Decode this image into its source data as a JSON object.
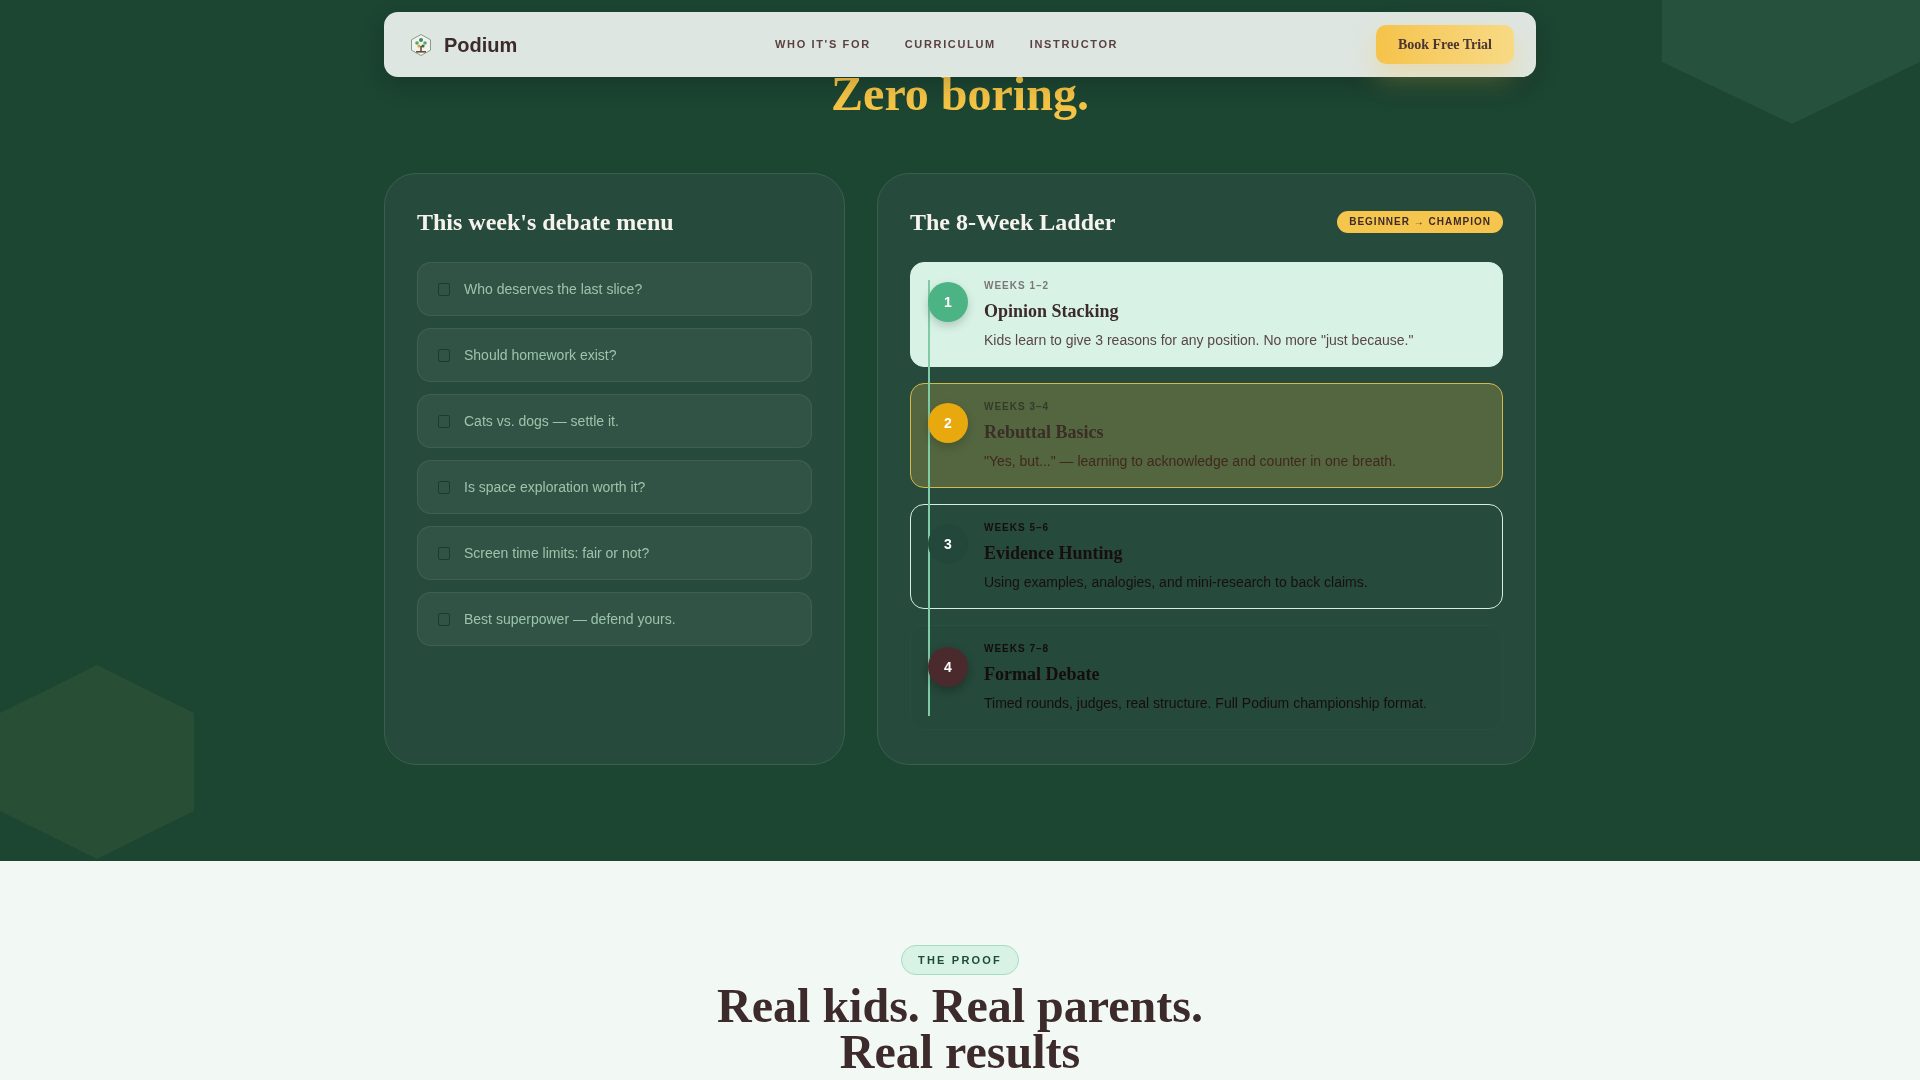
{
  "navbar": {
    "brand": "Podium",
    "links": [
      {
        "label": "WHO IT'S FOR"
      },
      {
        "label": "CURRICULUM"
      },
      {
        "label": "INSTRUCTOR"
      }
    ],
    "cta": "Book Free Trial"
  },
  "hero": {
    "headline": "Zero boring."
  },
  "debate_menu": {
    "title": "This week's debate menu",
    "items": [
      {
        "label": "Who deserves the last slice?",
        "checked": false
      },
      {
        "label": "Should homework exist?",
        "checked": false
      },
      {
        "label": "Cats vs. dogs — settle it.",
        "checked": false
      },
      {
        "label": "Is space exploration worth it?",
        "checked": false
      },
      {
        "label": "Screen time limits: fair or not?",
        "checked": false
      },
      {
        "label": "Best superpower — defend yours.",
        "checked": false
      }
    ]
  },
  "ladder": {
    "title": "The 8-Week Ladder",
    "badge": "BEGINNER → CHAMPION",
    "steps": [
      {
        "kind": "mint",
        "number": "1",
        "weeks": "WEEKS 1–2",
        "title": "Opinion Stacking",
        "description": "Kids learn to give 3 reasons for any position. No more \"just because.\""
      },
      {
        "kind": "gold",
        "number": "2",
        "weeks": "WEEKS 3–4",
        "title": "Rebuttal Basics",
        "description": "\"Yes, but...\" — learning to acknowledge and counter in one breath."
      },
      {
        "kind": "outline",
        "number": "3",
        "weeks": "WEEKS 5–6",
        "title": "Evidence Hunting",
        "description": "Using examples, analogies, and mini-research to back claims."
      },
      {
        "kind": "faded",
        "number": "4",
        "weeks": "WEEKS 7–8",
        "title": "Formal Debate",
        "description": "Timed rounds, judges, real structure. Full Podium championship format."
      }
    ]
  },
  "proof": {
    "tag": "THE PROOF",
    "headline": "Real kids. Real parents. Real results"
  }
}
